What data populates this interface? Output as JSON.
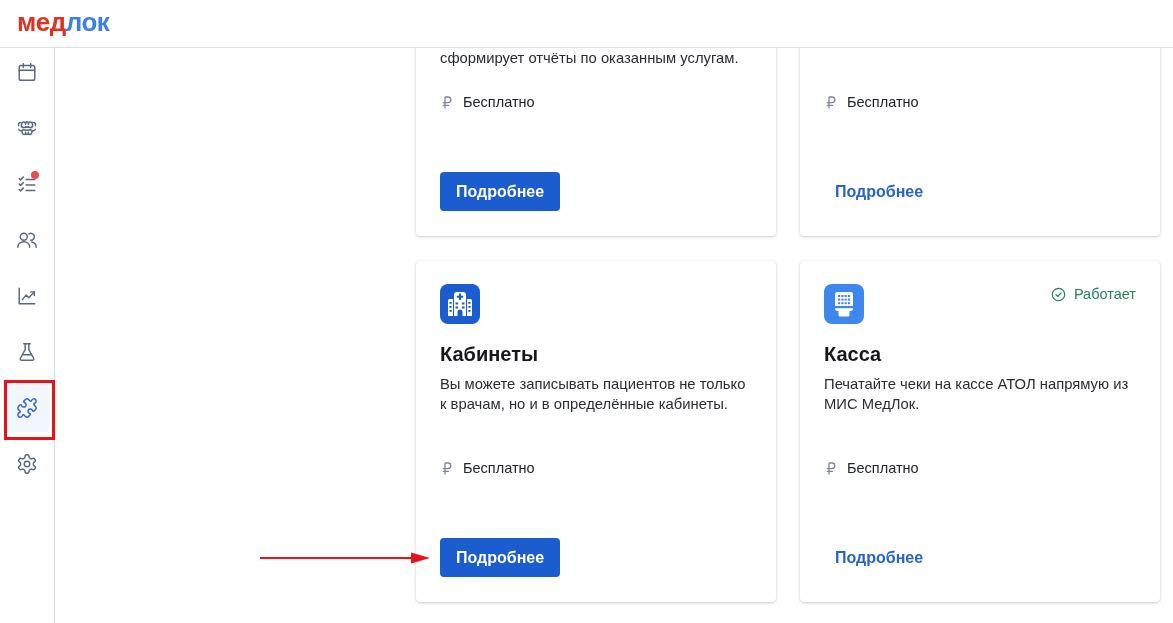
{
  "header": {
    "logo": [
      {
        "text": "мед",
        "color": "#e4311f"
      },
      {
        "text": "лок",
        "color": "#3b80e2"
      }
    ]
  },
  "sidebar": {
    "items": [
      {
        "kind": "calendar",
        "selected": false,
        "badge": false,
        "framed": false
      },
      {
        "kind": "teeth",
        "selected": false,
        "badge": false,
        "framed": false
      },
      {
        "kind": "checklist",
        "selected": false,
        "badge": true,
        "framed": false
      },
      {
        "kind": "people",
        "selected": false,
        "badge": false,
        "framed": false
      },
      {
        "kind": "chart",
        "selected": false,
        "badge": false,
        "framed": false
      },
      {
        "kind": "flask",
        "selected": false,
        "badge": false,
        "framed": false
      },
      {
        "kind": "puzzle",
        "selected": true,
        "badge": false,
        "framed": true
      },
      {
        "kind": "gear",
        "selected": false,
        "badge": false,
        "framed": false
      }
    ]
  },
  "cards": [
    {
      "description": "сформирует отчёты по оказанным услугам.",
      "price": "Бесплатно",
      "button": {
        "label": "Подробнее",
        "kind": "primary"
      },
      "pointed": false
    },
    {
      "price": "Бесплатно",
      "button": {
        "label": "Подробнее",
        "kind": "text"
      },
      "pointed": false
    },
    {
      "icon": {
        "kind": "building",
        "color": "#1b5dcf"
      },
      "title": "Кабинеты",
      "description": "Вы можете записывать пациентов не только к врачам, но и в определённые кабинеты.",
      "price": "Бесплатно",
      "button": {
        "label": "Подробнее",
        "kind": "primary"
      },
      "pointed": true
    },
    {
      "icon": {
        "kind": "register",
        "color": "#3d87ee"
      },
      "status": {
        "label": "Работает",
        "kind": "ok"
      },
      "title": "Касса",
      "description": "Печатайте чеки на кассе АТОЛ напрямую из МИС МедЛок.",
      "price": "Бесплатно",
      "button": {
        "label": "Подробнее",
        "kind": "text"
      },
      "pointed": false
    }
  ]
}
